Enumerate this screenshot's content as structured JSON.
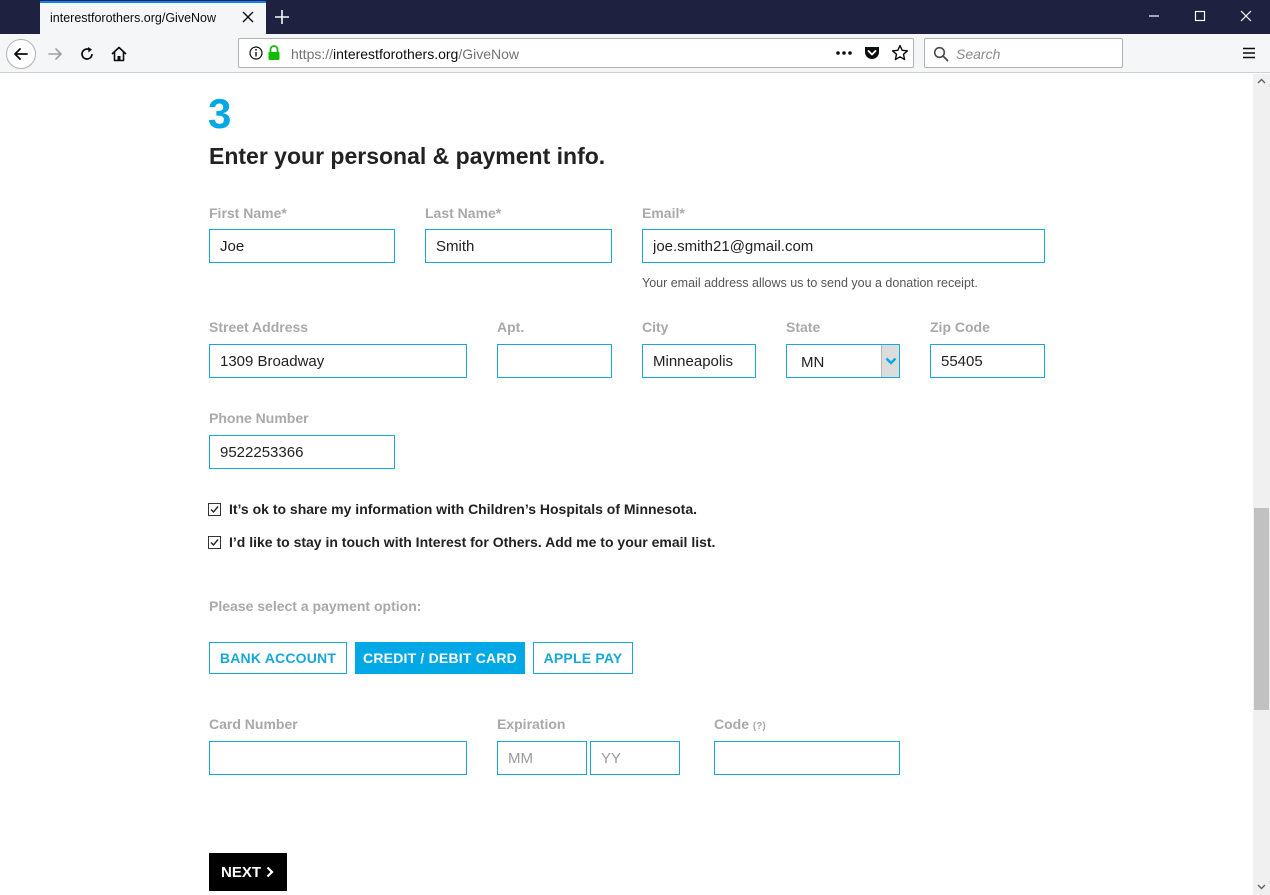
{
  "browser": {
    "tab_title": "interestforothers.org/GiveNow",
    "url_scheme": "https://",
    "url_host": "interestforothers.org",
    "url_path": "/GiveNow",
    "search_placeholder": "Search"
  },
  "page": {
    "step_number": "3",
    "heading": "Enter your personal & payment info.",
    "fields": {
      "first_name": {
        "label": "First Name*",
        "value": "Joe"
      },
      "last_name": {
        "label": "Last Name*",
        "value": "Smith"
      },
      "email": {
        "label": "Email*",
        "value": "joe.smith21@gmail.com",
        "help": "Your email address allows us to send you a donation receipt."
      },
      "street": {
        "label": "Street Address",
        "value": "1309 Broadway"
      },
      "apt": {
        "label": "Apt.",
        "value": ""
      },
      "city": {
        "label": "City",
        "value": "Minneapolis"
      },
      "state": {
        "label": "State",
        "value": "MN"
      },
      "zip": {
        "label": "Zip Code",
        "value": "55405"
      },
      "phone": {
        "label": "Phone Number",
        "value": "9522253366"
      }
    },
    "checkboxes": [
      {
        "label": "It’s ok to share my information with Children’s Hospitals of Minnesota.",
        "checked": true
      },
      {
        "label": "I’d like to stay in touch with Interest for Others. Add me to your email list.",
        "checked": true
      }
    ],
    "payment_prompt": "Please select a payment option:",
    "payment_options": [
      "BANK ACCOUNT",
      "CREDIT / DEBIT CARD",
      "APPLE PAY"
    ],
    "payment_selected": "CREDIT / DEBIT CARD",
    "card": {
      "number_label": "Card Number",
      "expiration_label": "Expiration",
      "month_placeholder": "MM",
      "year_placeholder": "YY",
      "code_label": "Code",
      "code_hint": "(?)"
    },
    "next_label": "NEXT",
    "accent_color": "#00a9e6"
  }
}
